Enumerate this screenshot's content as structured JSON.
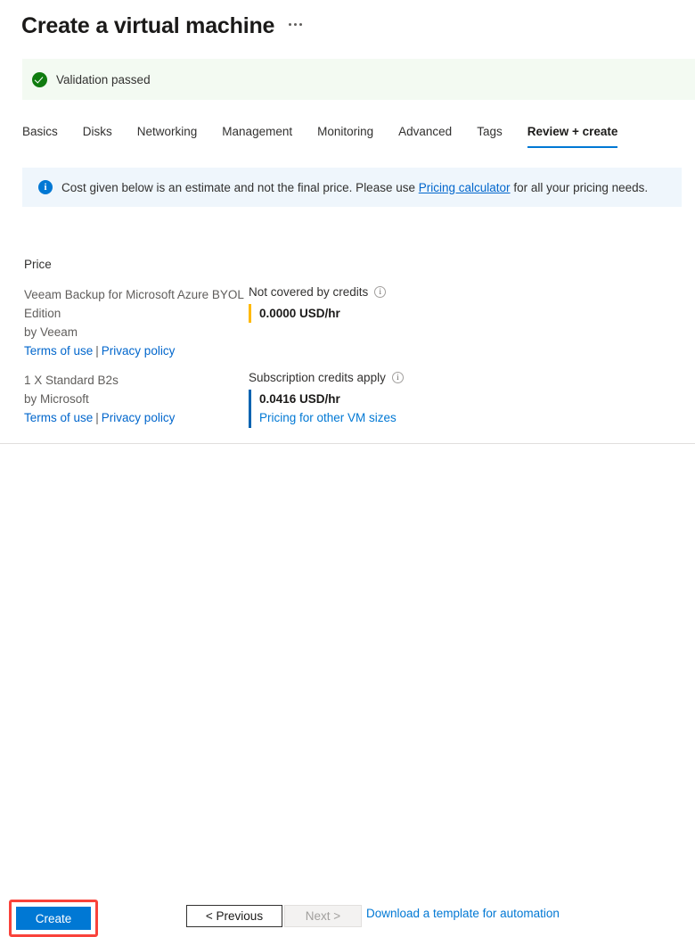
{
  "header": {
    "title": "Create a virtual machine",
    "more_menu": "..."
  },
  "validation": {
    "icon": "check-circle-icon",
    "message": "Validation passed",
    "background_color": "#f3faf2",
    "icon_color": "#107c10"
  },
  "tabs": [
    {
      "label": "Basics",
      "active": false
    },
    {
      "label": "Disks",
      "active": false
    },
    {
      "label": "Networking",
      "active": false
    },
    {
      "label": "Management",
      "active": false
    },
    {
      "label": "Monitoring",
      "active": false
    },
    {
      "label": "Advanced",
      "active": false
    },
    {
      "label": "Tags",
      "active": false
    },
    {
      "label": "Review + create",
      "active": true
    }
  ],
  "info_banner": {
    "icon": "info-circle-icon",
    "text_before": "Cost given below is an estimate and not the final price. Please use",
    "link": "Pricing calculator",
    "text_after": "for all your pricing needs.",
    "background_color": "#eff6fc",
    "icon_color": "#0078d4"
  },
  "price": {
    "heading": "Price",
    "rows": [
      {
        "offer_name": "Veeam Backup for Microsoft Azure BYOL Edition",
        "publisher": "by Veeam",
        "terms_link": "Terms of use",
        "separator": "|",
        "privacy_link": "Privacy policy",
        "cost_label": "Not covered by credits",
        "cost_info_icon": "info-icon",
        "cost_value": "0.0000 USD/hr",
        "bar_color": "#ffb900",
        "extra_link": null
      },
      {
        "offer_name": "1 X Standard B2s",
        "publisher": "by Microsoft",
        "terms_link": "Terms of use",
        "separator": "|",
        "privacy_link": "Privacy policy",
        "cost_label": "Subscription credits apply",
        "cost_info_icon": "info-icon",
        "cost_value": "0.0416 USD/hr",
        "bar_color": "#0063b1",
        "extra_link": "Pricing for other VM sizes"
      }
    ]
  },
  "footer": {
    "create_label": "Create",
    "previous_label": "< Previous",
    "next_label": "Next >",
    "download_label": "Download a template for automation",
    "create_color": "#0078d4",
    "highlight_color": "#f9423a"
  }
}
